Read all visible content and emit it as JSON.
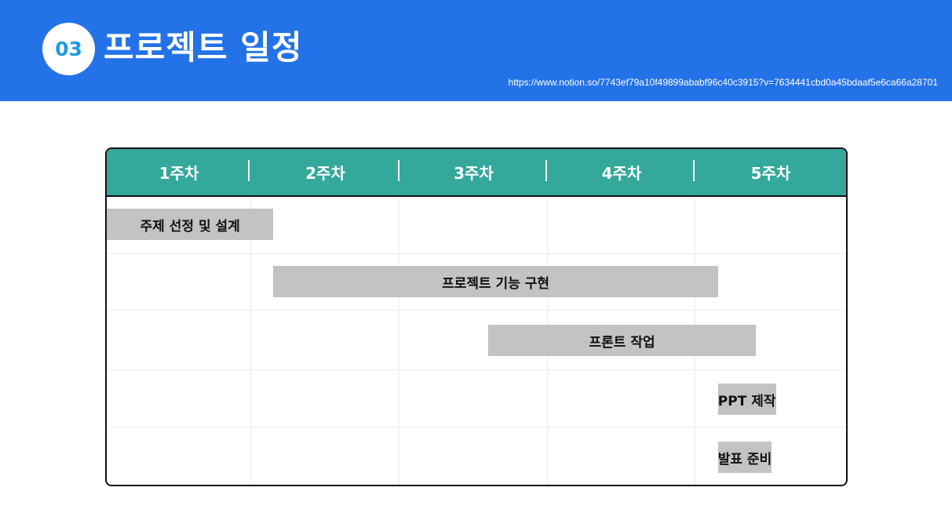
{
  "header": {
    "number": "03",
    "title": "프로젝트 일정",
    "url": "https://www.notion.so/7743ef79a10f49899ababf96c40c3915?v=7634441cbd0a45bdaaf5e6ca66a28701",
    "background_color": "#2472e8"
  },
  "schedule": {
    "header_color": "#33a89b",
    "bar_color": "#c3c3c3",
    "weeks": [
      "1주차",
      "2주차",
      "3주차",
      "4주차",
      "5주차"
    ],
    "tasks": [
      {
        "label": "주제 선정 및 설계",
        "start_week": 1.0,
        "end_week": 2.15
      },
      {
        "label": "프로젝트 기능 구현",
        "start_week": 2.15,
        "end_week": 5.15
      },
      {
        "label": "프론트 작업",
        "start_week": 3.6,
        "end_week": 5.4
      },
      {
        "label": "PPT 제작",
        "start_week": 5.15,
        "end_week": 6.0
      },
      {
        "label": "발표 준비",
        "start_week": 5.15,
        "end_week": 6.0
      }
    ]
  }
}
